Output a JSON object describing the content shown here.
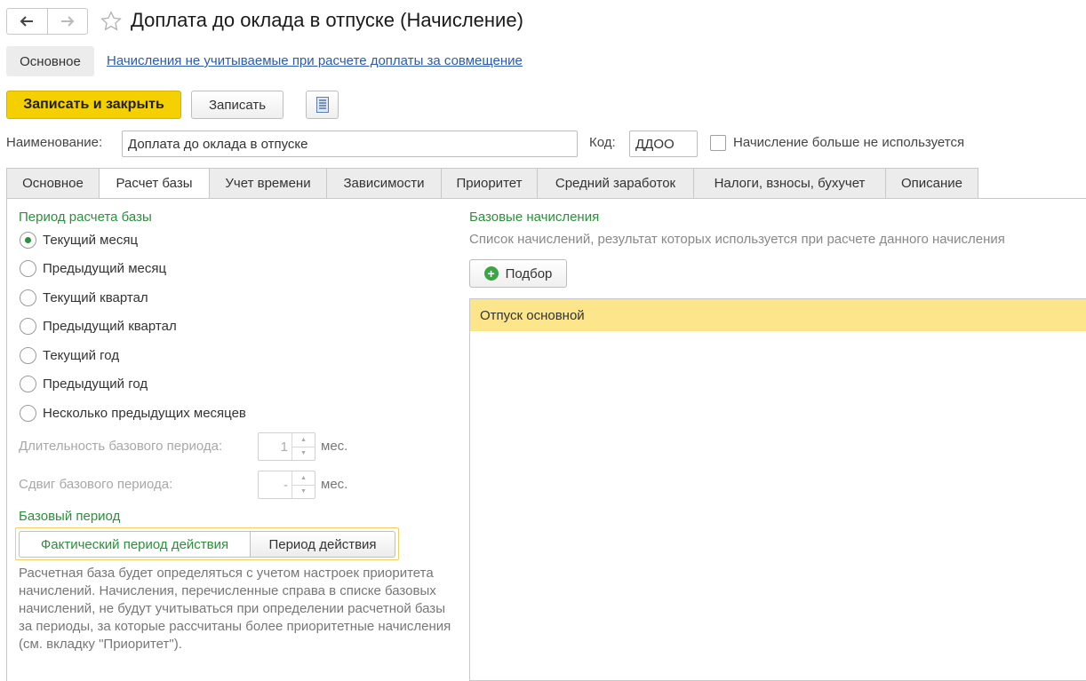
{
  "window": {
    "title": "Доплата до оклада в отпуске (Начисление)"
  },
  "section_tabs": {
    "main_label": "Основное",
    "link_label": "Начисления не учитываемые при расчете доплаты за совмещение"
  },
  "toolbar": {
    "save_close_label": "Записать и закрыть",
    "save_label": "Записать"
  },
  "form": {
    "name_label": "Наименование:",
    "name_value": "Доплата до оклада в отпуске",
    "code_label": "Код:",
    "code_value": "ДДОО",
    "unused_label": "Начисление больше не используется"
  },
  "tabs": [
    {
      "label": "Основное"
    },
    {
      "label": "Расчет базы"
    },
    {
      "label": "Учет времени"
    },
    {
      "label": "Зависимости"
    },
    {
      "label": "Приоритет"
    },
    {
      "label": "Средний заработок"
    },
    {
      "label": "Налоги, взносы, бухучет"
    },
    {
      "label": "Описание"
    }
  ],
  "active_tab": "Расчет базы",
  "base_period": {
    "title": "Период расчета базы",
    "options": [
      {
        "label": "Текущий месяц"
      },
      {
        "label": "Предыдущий месяц"
      },
      {
        "label": "Текущий квартал"
      },
      {
        "label": "Предыдущий квартал"
      },
      {
        "label": "Текущий год"
      },
      {
        "label": "Предыдущий год"
      },
      {
        "label": "Несколько предыдущих месяцев"
      }
    ],
    "selected": "Текущий месяц",
    "duration_label": "Длительность базового периода:",
    "duration_value": "1",
    "duration_unit": "мес.",
    "shift_label": "Сдвиг базового периода:",
    "shift_value": "-",
    "shift_unit": "мес."
  },
  "base_period_kind": {
    "title": "Базовый период",
    "option_actual": "Фактический период действия",
    "option_period": "Период действия",
    "description": "Расчетная база будет определяться с учетом настроек приоритета начислений. Начисления, перечисленные справа в списке базовых начислений, не будут учитываться при определении расчетной базы за периоды, за которые рассчитаны более приоритетные начисления (см. вкладку \"Приоритет\")."
  },
  "base_accruals": {
    "title": "Базовые начисления",
    "subtitle": "Список начислений, результат которых используется при расчете данного начисления",
    "pick_label": "Подбор",
    "items": [
      {
        "label": "Отпуск основной"
      }
    ]
  },
  "colors": {
    "accent_yellow": "#f5d000",
    "group_green": "#2c8f3c",
    "link_blue": "#2a5bb0",
    "selected_row": "#fde58c"
  }
}
